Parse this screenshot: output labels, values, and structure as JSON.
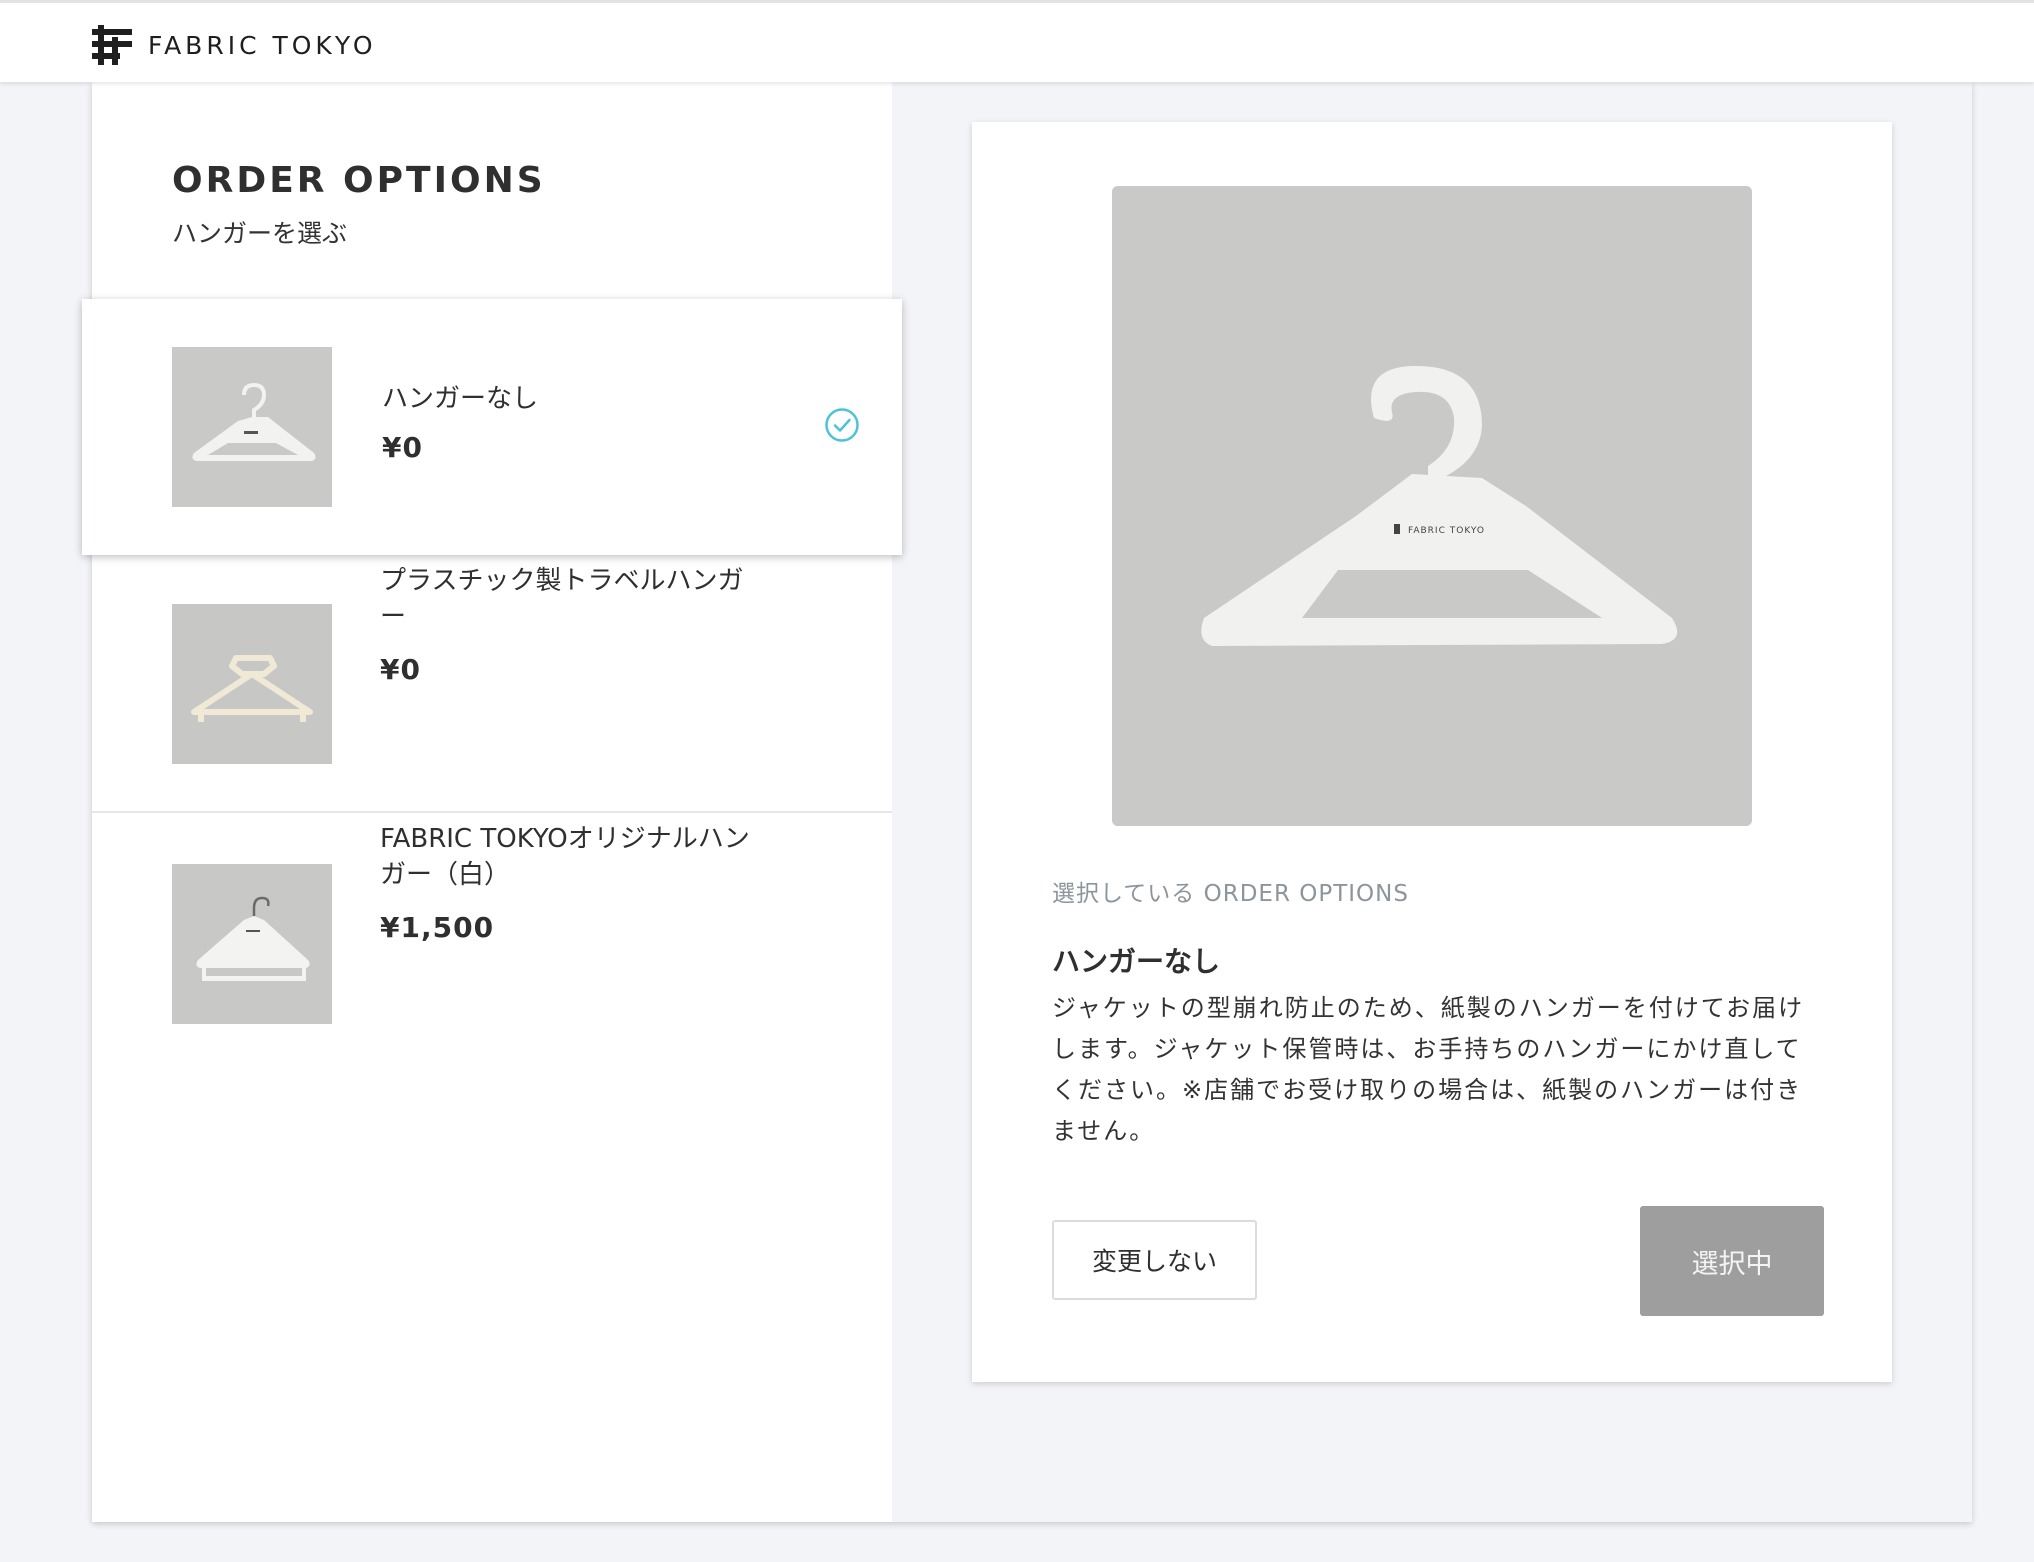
{
  "header": {
    "brand": "FABRIC TOKYO"
  },
  "panel": {
    "title": "ORDER OPTIONS",
    "subtitle": "ハンガーを選ぶ"
  },
  "options": [
    {
      "name": "ハンガーなし",
      "price": "¥0",
      "selected": true,
      "thumb_icon": "paper-hanger-icon"
    },
    {
      "name": "プラスチック製トラベルハンガー",
      "price": "¥0",
      "selected": false,
      "thumb_icon": "plastic-travel-hanger-icon"
    },
    {
      "name": "FABRIC TOKYOオリジナルハンガー（白）",
      "price": "¥1,500",
      "selected": false,
      "thumb_icon": "original-white-hanger-icon"
    }
  ],
  "detail": {
    "image_icon": "paper-hanger-icon",
    "image_brand_text": "FABRIC TOKYO",
    "caption": "選択している ORDER OPTIONS",
    "name": "ハンガーなし",
    "description": "ジャケットの型崩れ防止のため、紙製のハンガーを付けてお届けします。ジャケット保管時は、お手持ちのハンガーにかけ直してください。※店舗でお受け取りの場合は、紙製のハンガーは付きません。",
    "no_change_label": "変更しない",
    "selected_label": "選択中"
  },
  "colors": {
    "accent_check": "#4fc3d6",
    "selected_button": "#9e9e9e",
    "background": "#f3f4f8"
  }
}
